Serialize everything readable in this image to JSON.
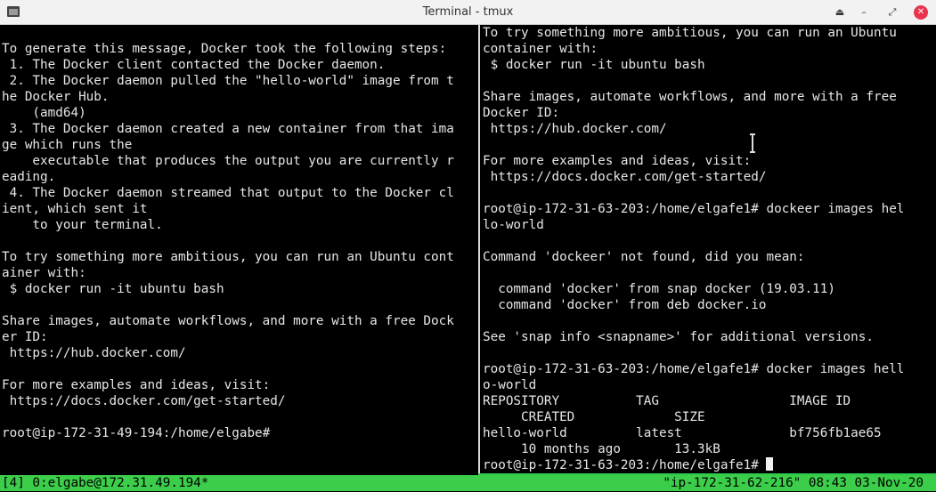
{
  "window": {
    "title": "Terminal - tmux",
    "buttons": {
      "shade": "⏏",
      "minimize": "–",
      "maximize": "⤢",
      "close": "✕"
    }
  },
  "left_pane": {
    "lines": [
      "To generate this message, Docker took the following steps:",
      " 1. The Docker client contacted the Docker daemon.",
      " 2. The Docker daemon pulled the \"hello-world\" image from t",
      "he Docker Hub.",
      "    (amd64)",
      " 3. The Docker daemon created a new container from that ima",
      "ge which runs the",
      "    executable that produces the output you are currently r",
      "eading.",
      " 4. The Docker daemon streamed that output to the Docker cl",
      "ient, which sent it",
      "    to your terminal.",
      "",
      "To try something more ambitious, you can run an Ubuntu cont",
      "ainer with:",
      " $ docker run -it ubuntu bash",
      "",
      "Share images, automate workflows, and more with a free Dock",
      "er ID:",
      " https://hub.docker.com/",
      "",
      "For more examples and ideas, visit:",
      " https://docs.docker.com/get-started/",
      "",
      "root@ip-172-31-49-194:/home/elgabe#"
    ]
  },
  "right_pane": {
    "lines": [
      "To try something more ambitious, you can run an Ubuntu",
      "container with:",
      " $ docker run -it ubuntu bash",
      "",
      "Share images, automate workflows, and more with a free",
      "Docker ID:",
      " https://hub.docker.com/",
      "",
      "For more examples and ideas, visit:",
      " https://docs.docker.com/get-started/",
      "",
      "root@ip-172-31-63-203:/home/elgafe1# dockeer images hel",
      "lo-world",
      "",
      "Command 'dockeer' not found, did you mean:",
      "",
      "  command 'docker' from snap docker (19.03.11)",
      "  command 'docker' from deb docker.io",
      "",
      "See 'snap info <snapname>' for additional versions.",
      "",
      "root@ip-172-31-63-203:/home/elgafe1# docker images hell",
      "o-world",
      "REPOSITORY          TAG                 IMAGE ID",
      "     CREATED             SIZE",
      "hello-world         latest              bf756fb1ae65",
      "     10 months ago       13.3kB"
    ],
    "prompt": "root@ip-172-31-63-203:/home/elgafe1# "
  },
  "status_bar": {
    "left": "[4] 0:elgabe@172.31.49.194*",
    "right": "\"ip-172-31-62-216\" 08:43 03-Nov-20"
  },
  "colors": {
    "status_bg": "#3cce4a",
    "active_border": "#2ec84a",
    "terminal_bg": "#000000",
    "terminal_fg": "#e6e6e6",
    "close_button": "#e8344c"
  }
}
